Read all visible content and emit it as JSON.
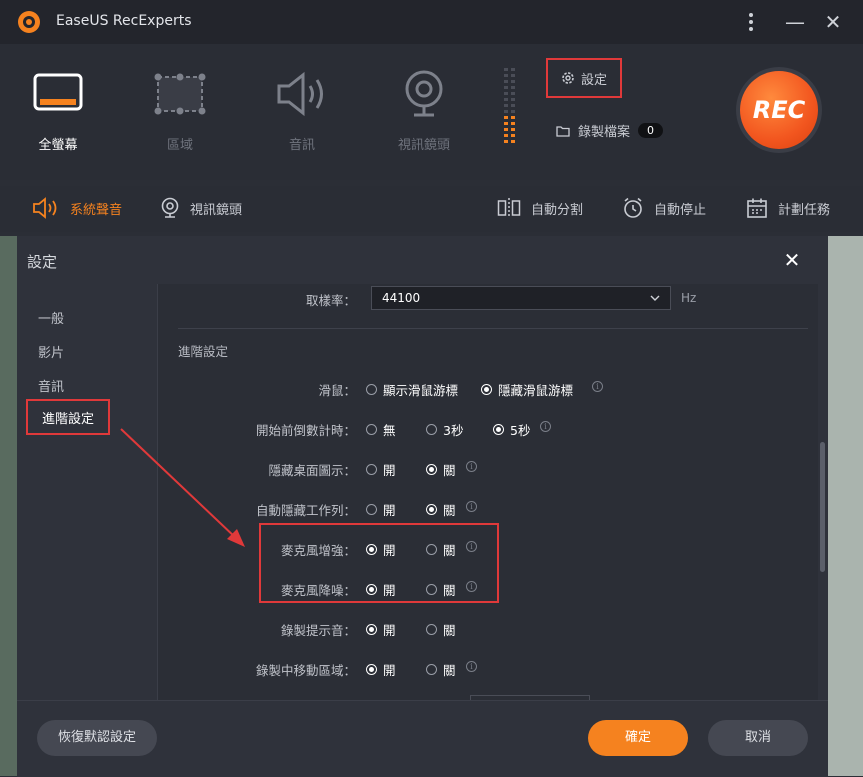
{
  "app": {
    "title": "EaseUS RecExperts",
    "accent": "#f5821f",
    "highlight": "#e0393a"
  },
  "window_controls": {
    "menu_icon": "kebab-menu-icon",
    "minimize": "—",
    "close": "✕"
  },
  "modes": [
    {
      "label": "全螢幕",
      "icon": "monitor-icon",
      "active": true
    },
    {
      "label": "區域",
      "icon": "region-select-icon",
      "active": false
    },
    {
      "label": "音訊",
      "icon": "speaker-icon",
      "active": false
    },
    {
      "label": "視訊鏡頭",
      "icon": "webcam-icon",
      "active": false
    }
  ],
  "settings_button": {
    "label": "設定",
    "icon": "gear-icon"
  },
  "recorded_files": {
    "label": "錄製檔案",
    "count": "0",
    "icon": "folder-icon"
  },
  "rec_button": {
    "label": "REC"
  },
  "subtoolbar": {
    "left": [
      {
        "label": "系統聲音",
        "icon": "speaker-icon",
        "active": true
      },
      {
        "label": "視訊鏡頭",
        "icon": "webcam-icon",
        "active": false
      }
    ],
    "right": [
      {
        "label": "自動分割",
        "icon": "split-icon"
      },
      {
        "label": "自動停止",
        "icon": "alarm-clock-icon"
      },
      {
        "label": "計劃任務",
        "icon": "calendar-icon"
      }
    ]
  },
  "dialog": {
    "title": "設定",
    "close": "✕",
    "nav": [
      "一般",
      "影片",
      "音訊",
      "進階設定"
    ],
    "nav_selected": "進階設定",
    "sample_rate": {
      "label": "取樣率：",
      "value": "44100",
      "unit": "Hz"
    },
    "section_title": "進階設定",
    "rows": [
      {
        "label": "滑鼠：",
        "options": [
          {
            "text": "顯示滑鼠游標",
            "on": false
          },
          {
            "text": "隱藏滑鼠游標",
            "on": true
          }
        ],
        "info": true
      },
      {
        "label": "開始前倒數計時：",
        "options": [
          {
            "text": "無",
            "on": false
          },
          {
            "text": "3秒",
            "on": false
          },
          {
            "text": "5秒",
            "on": true
          }
        ],
        "info": true
      },
      {
        "label": "隱藏桌面圖示：",
        "options": [
          {
            "text": "開",
            "on": false
          },
          {
            "text": "關",
            "on": true
          }
        ],
        "info": true
      },
      {
        "label": "自動隱藏工作列：",
        "options": [
          {
            "text": "開",
            "on": false
          },
          {
            "text": "關",
            "on": true
          }
        ],
        "info": true
      },
      {
        "label": "麥克風增強：",
        "options": [
          {
            "text": "開",
            "on": true
          },
          {
            "text": "關",
            "on": false
          }
        ],
        "info": true
      },
      {
        "label": "麥克風降噪：",
        "options": [
          {
            "text": "開",
            "on": true
          },
          {
            "text": "關",
            "on": false
          }
        ],
        "info": true
      },
      {
        "label": "錄製提示音：",
        "options": [
          {
            "text": "開",
            "on": true
          },
          {
            "text": "關",
            "on": false
          }
        ],
        "info": false
      },
      {
        "label": "錄製中移動區域：",
        "options": [
          {
            "text": "開",
            "on": true
          },
          {
            "text": "關",
            "on": false
          }
        ],
        "info": true
      }
    ],
    "footer": {
      "restore": "恢復默認設定",
      "ok": "確定",
      "cancel": "取消"
    }
  }
}
